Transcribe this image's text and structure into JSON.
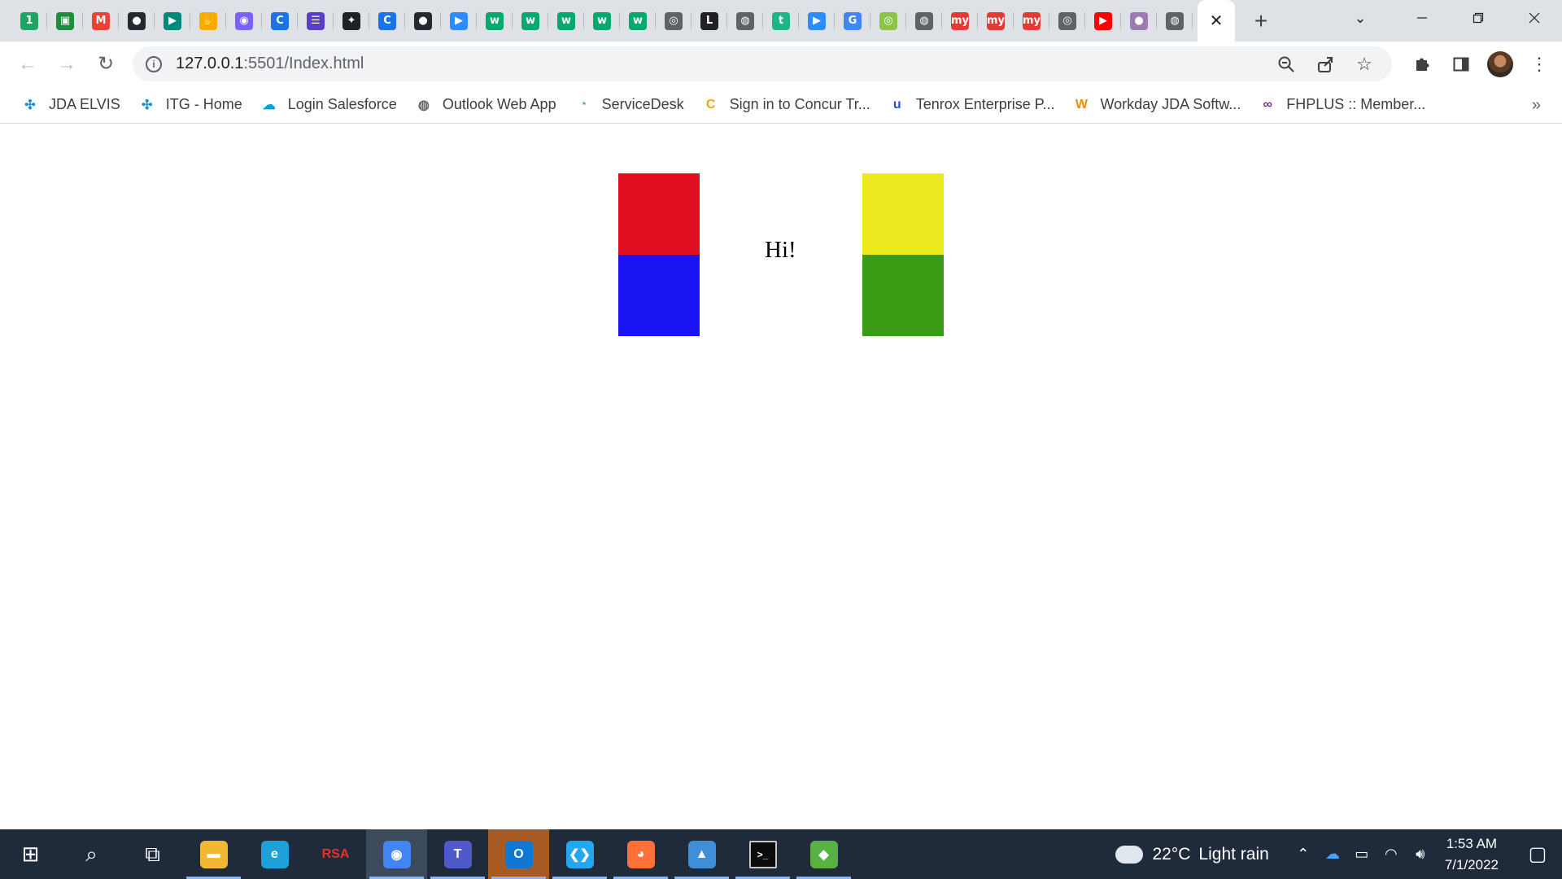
{
  "browser": {
    "tabs": [
      {
        "icon": "green-circle-one-icon",
        "glyph": "1",
        "color": "#1fa463"
      },
      {
        "icon": "green-square-app-icon",
        "glyph": "▣",
        "color": "#1e8e3e"
      },
      {
        "icon": "gmail-icon",
        "glyph": "M",
        "color": "#ea4335"
      },
      {
        "icon": "github-icon",
        "glyph": "●",
        "color": "#24292f"
      },
      {
        "icon": "google-meet-icon",
        "glyph": "▶",
        "color": "#00897b"
      },
      {
        "icon": "yellow-app-icon",
        "glyph": "✋",
        "color": "#f9ab00"
      },
      {
        "icon": "purple-app-icon",
        "glyph": "◉",
        "color": "#7b61ff"
      },
      {
        "icon": "blue-c-icon",
        "glyph": "C",
        "color": "#1a73e8"
      },
      {
        "icon": "list-app-icon",
        "glyph": "☰",
        "color": "#5b3cc4"
      },
      {
        "icon": "sparkle-icon",
        "glyph": "✦",
        "color": "#202124"
      },
      {
        "icon": "blue-c-icon",
        "glyph": "C",
        "color": "#1a73e8"
      },
      {
        "icon": "github-icon",
        "glyph": "●",
        "color": "#24292f"
      },
      {
        "icon": "zoom-icon",
        "glyph": "▶",
        "color": "#2d8cff"
      },
      {
        "icon": "w3schools-icon",
        "glyph": "w",
        "color": "#04aa6d"
      },
      {
        "icon": "w3schools-icon",
        "glyph": "w",
        "color": "#04aa6d"
      },
      {
        "icon": "w3schools-icon",
        "glyph": "w",
        "color": "#04aa6d"
      },
      {
        "icon": "w3schools-icon",
        "glyph": "w",
        "color": "#04aa6d"
      },
      {
        "icon": "w3schools-icon",
        "glyph": "w",
        "color": "#04aa6d"
      },
      {
        "icon": "chromium-icon",
        "glyph": "◎",
        "color": "#5f6368"
      },
      {
        "icon": "letter-l-icon",
        "glyph": "L",
        "color": "#202124"
      },
      {
        "icon": "globe-icon",
        "glyph": "◍",
        "color": "#5f6368"
      },
      {
        "icon": "teal-t-icon",
        "glyph": "t",
        "color": "#1db584"
      },
      {
        "icon": "zoom-icon",
        "glyph": "▶",
        "color": "#2d8cff"
      },
      {
        "icon": "google-icon",
        "glyph": "G",
        "color": "#4285f4"
      },
      {
        "icon": "green-ring-icon",
        "glyph": "◎",
        "color": "#8bc34a"
      },
      {
        "icon": "globe-icon",
        "glyph": "◍",
        "color": "#5f6368"
      },
      {
        "icon": "makemytrip-icon",
        "glyph": "my",
        "color": "#e53935"
      },
      {
        "icon": "makemytrip-icon",
        "glyph": "my",
        "color": "#e53935"
      },
      {
        "icon": "makemytrip-icon",
        "glyph": "my",
        "color": "#e53935"
      },
      {
        "icon": "chromium-icon",
        "glyph": "◎",
        "color": "#5f6368"
      },
      {
        "icon": "youtube-icon",
        "glyph": "▶",
        "color": "#ff0000"
      },
      {
        "icon": "profile-photo-icon",
        "glyph": "●",
        "color": "#9c7bb5"
      },
      {
        "icon": "globe-icon",
        "glyph": "◍",
        "color": "#5f6368"
      }
    ],
    "active_tab_close": "✕",
    "new_tab": "+",
    "address": {
      "host": "127.0.0.1",
      "rest": ":5501/Index.html"
    },
    "bookmarks": [
      {
        "label": "JDA ELVIS",
        "icon": "jda-icon",
        "glyph": "✣",
        "color": "#1a8fd8"
      },
      {
        "label": "ITG - Home",
        "icon": "jda-icon",
        "glyph": "✣",
        "color": "#1a8fd8"
      },
      {
        "label": "Login  Salesforce",
        "icon": "salesforce-cloud-icon",
        "glyph": "☁",
        "color": "#00a1e0"
      },
      {
        "label": "Outlook Web App",
        "icon": "globe-icon",
        "glyph": "◍",
        "color": "#5f6368"
      },
      {
        "label": "ServiceDesk",
        "icon": "servicedesk-icon",
        "glyph": "◔",
        "color": "#62a8a8"
      },
      {
        "label": "Sign in to Concur Tr...",
        "icon": "concur-icon",
        "glyph": "C",
        "color": "#f0ab00"
      },
      {
        "label": "Tenrox Enterprise P...",
        "icon": "tenrox-icon",
        "glyph": "u",
        "color": "#1f4fd1"
      },
      {
        "label": "Workday JDA Softw...",
        "icon": "workday-icon",
        "glyph": "W",
        "color": "#f38b00"
      },
      {
        "label": "FHPLUS :: Member...",
        "icon": "fhplus-icon",
        "glyph": "∞",
        "color": "#7a2b8f"
      }
    ],
    "bookmarks_more": "»"
  },
  "page": {
    "greeting": "Hi!",
    "colors": {
      "red": "#e20f23",
      "blue": "#1a14f5",
      "yellow": "#ece91e",
      "green": "#3a9c14"
    }
  },
  "taskbar": {
    "apps": [
      {
        "icon": "windows-start-icon",
        "glyph": "⊞",
        "color": "#ffffff"
      },
      {
        "icon": "search-icon",
        "glyph": "⌕",
        "color": "#ffffff"
      },
      {
        "icon": "task-view-icon",
        "glyph": "⧉",
        "color": "#ffffff"
      },
      {
        "icon": "file-explorer-icon",
        "glyph": "▬",
        "color": "#f3b833"
      },
      {
        "icon": "edge-icon",
        "glyph": "e",
        "color": "#1fa0d8"
      },
      {
        "icon": "rsa-icon",
        "glyph": "RSA",
        "color": "#e4322b"
      },
      {
        "icon": "chrome-icon",
        "glyph": "◉",
        "color": "#4285f4"
      },
      {
        "icon": "teams-icon",
        "glyph": "T",
        "color": "#5059c9"
      },
      {
        "icon": "outlook-icon",
        "glyph": "O",
        "color": "#0f78d4"
      },
      {
        "icon": "vscode-icon",
        "glyph": "❮❯",
        "color": "#22a7f0"
      },
      {
        "icon": "firefox-icon",
        "glyph": "◕",
        "color": "#ff7139"
      },
      {
        "icon": "photos-icon",
        "glyph": "▲",
        "color": "#3f8fd8"
      },
      {
        "icon": "terminal-icon",
        "glyph": ">_",
        "color": "#0c0c0c"
      },
      {
        "icon": "git-icon",
        "glyph": "◆",
        "color": "#59b043"
      }
    ],
    "weather": {
      "temp": "22°C",
      "condition": "Light rain"
    },
    "clock": {
      "time": "1:53 AM",
      "date": "7/1/2022"
    }
  }
}
